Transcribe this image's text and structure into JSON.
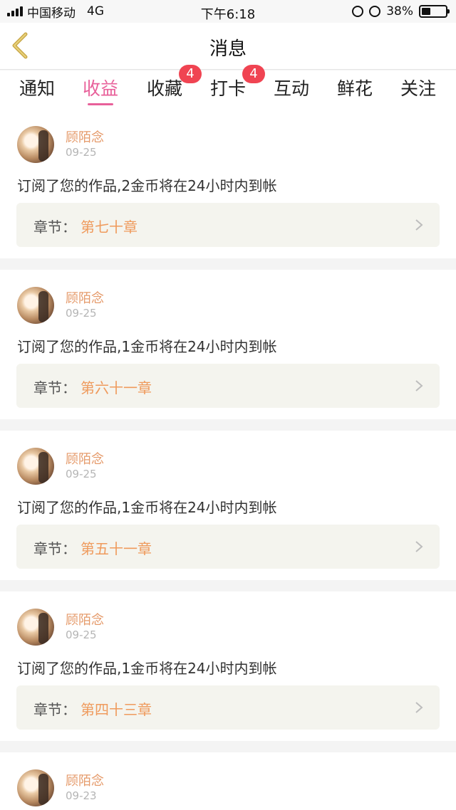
{
  "status_bar": {
    "carrier": "中国移动",
    "network": "4G",
    "time": "下午6:18",
    "battery": "38%",
    "battery_level": 0.38
  },
  "nav": {
    "title": "消息",
    "back_icon": "chevron-left-icon"
  },
  "tabs": [
    {
      "label": "通知"
    },
    {
      "label": "收益",
      "active": true
    },
    {
      "label": "收藏",
      "badge": "4"
    },
    {
      "label": "打卡",
      "badge": "4"
    },
    {
      "label": "互动"
    },
    {
      "label": "鲜花"
    },
    {
      "label": "关注"
    }
  ],
  "colors": {
    "accent": "#e8609a",
    "badge": "#f04452",
    "username": "#e59a6a",
    "chapter": "#ef9a5c"
  },
  "messages": [
    {
      "username": "顾陌念",
      "date": "09-25",
      "text": "订阅了您的作品,2金币将在24小时内到帐",
      "chapter_label": "章节：",
      "chapter": "第七十章"
    },
    {
      "username": "顾陌念",
      "date": "09-25",
      "text": "订阅了您的作品,1金币将在24小时内到帐",
      "chapter_label": "章节：",
      "chapter": "第六十一章"
    },
    {
      "username": "顾陌念",
      "date": "09-25",
      "text": "订阅了您的作品,1金币将在24小时内到帐",
      "chapter_label": "章节：",
      "chapter": "第五十一章"
    },
    {
      "username": "顾陌念",
      "date": "09-25",
      "text": "订阅了您的作品,1金币将在24小时内到帐",
      "chapter_label": "章节：",
      "chapter": "第四十三章"
    },
    {
      "username": "顾陌念",
      "date": "09-23",
      "text": "",
      "chapter_label": "",
      "chapter": ""
    }
  ]
}
